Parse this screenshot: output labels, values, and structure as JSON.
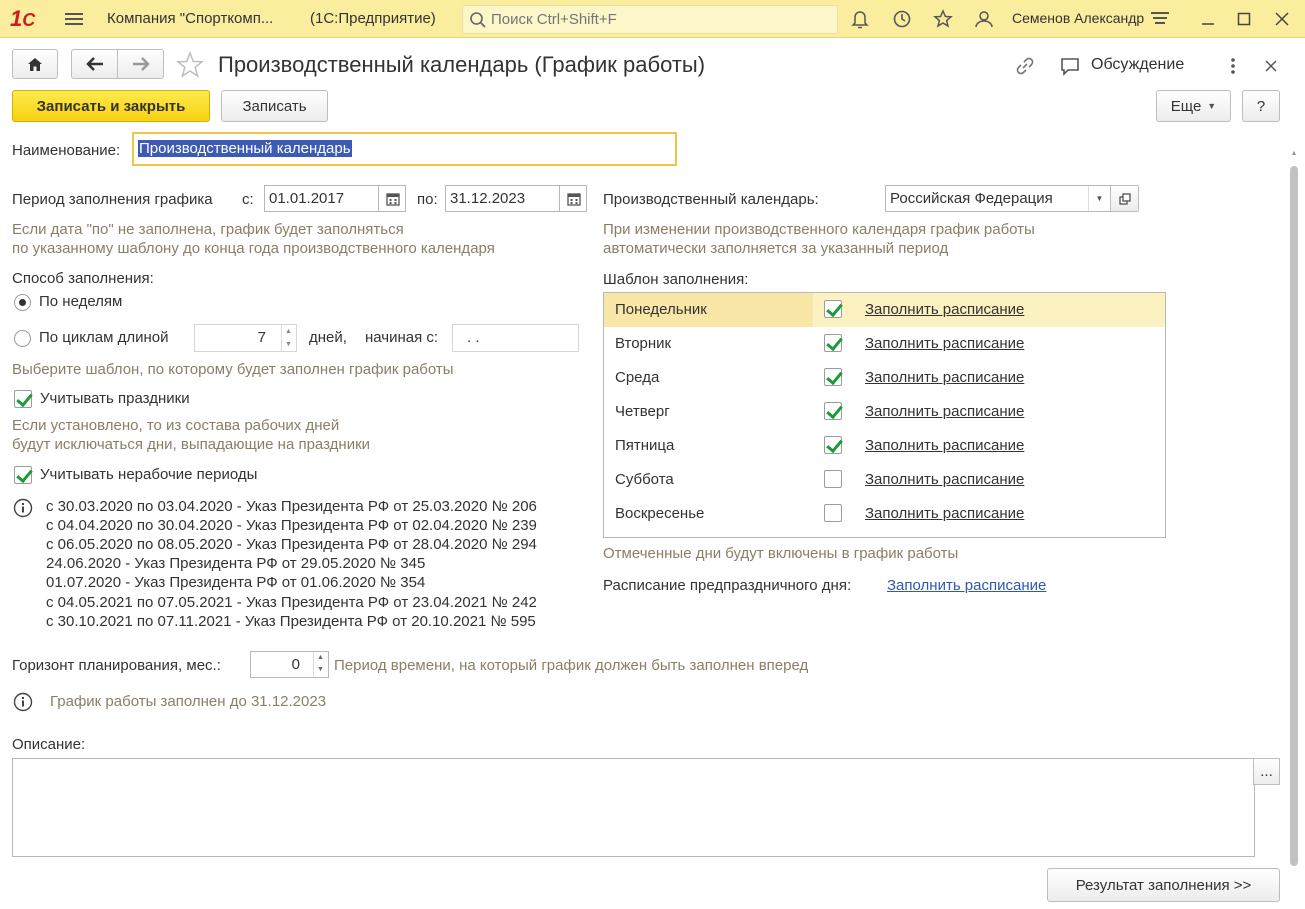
{
  "titlebar": {
    "app_name": "Компания \"Спорткомп...",
    "platform": "(1С:Предприятие)",
    "search_placeholder": "Поиск Ctrl+Shift+F",
    "user_name": "Семенов Александр"
  },
  "header": {
    "title": "Производственный календарь (График работы)",
    "discussion_label": "Обсуждение"
  },
  "toolbar": {
    "save_close_label": "Записать и закрыть",
    "save_label": "Записать",
    "more_label": "Еще",
    "help_label": "?"
  },
  "form": {
    "name_label": "Наименование:",
    "name_value": "Производственный календарь",
    "period_label": "Период заполнения графика",
    "period_from_label": "с:",
    "period_from": "01.01.2017",
    "period_to_label": "по:",
    "period_to": "31.12.2023",
    "period_hint_1": "Если дата \"по\" не заполнена, график будет заполняться",
    "period_hint_2": "по указанному шаблону до конца года производственного календаря",
    "fill_method_label": "Способ заполнения:",
    "by_weeks_label": "По неделям",
    "by_cycles_label": "По циклам длиной",
    "cycle_length": "7",
    "days_label": "дней,",
    "starting_label": "начиная с:",
    "starting_value": " .  .",
    "template_hint": "Выберите шаблон, по которому будет заполнен график работы",
    "holidays_label": "Учитывать праздники",
    "holidays_hint_1": "Если установлено, то из состава рабочих дней",
    "holidays_hint_2": "будут исключаться дни, выпадающие на праздники",
    "nonwork_label": "Учитывать нерабочие периоды",
    "nonwork_periods": [
      "с 30.03.2020 по 03.04.2020 - Указ Президента РФ от 25.03.2020 № 206",
      "с 04.04.2020 по 30.04.2020 - Указ Президента РФ от 02.04.2020 № 239",
      "с 06.05.2020 по 08.05.2020 - Указ Президента РФ от 28.04.2020 № 294",
      "24.06.2020 - Указ Президента РФ от 29.05.2020 № 345",
      "01.07.2020 - Указ Президента РФ от 01.06.2020 № 354",
      "с 04.05.2021 по 07.05.2021 - Указ Президента РФ от 23.04.2021 № 242",
      "с 30.10.2021 по 07.11.2021 - Указ Президента РФ от 20.10.2021 № 595"
    ],
    "horizon_label": "Горизонт планирования, мес.:",
    "horizon_value": "0",
    "horizon_hint": "Период времени, на который график должен быть заполнен вперед",
    "filled_until": "График работы заполнен до 31.12.2023",
    "description_label": "Описание:",
    "description_more": "...",
    "result_button": "Результат заполнения >>"
  },
  "right": {
    "calendar_label": "Производственный календарь:",
    "calendar_value": "Российская Федерация",
    "calendar_hint_1": "При изменении производственного календаря график работы",
    "calendar_hint_2": "автоматически заполняется за указанный период",
    "template_label": "Шаблон заполнения:",
    "days": [
      {
        "name": "Понедельник",
        "checked": true,
        "link": "Заполнить расписание"
      },
      {
        "name": "Вторник",
        "checked": true,
        "link": "Заполнить расписание"
      },
      {
        "name": "Среда",
        "checked": true,
        "link": "Заполнить расписание"
      },
      {
        "name": "Четверг",
        "checked": true,
        "link": "Заполнить расписание"
      },
      {
        "name": "Пятница",
        "checked": true,
        "link": "Заполнить расписание"
      },
      {
        "name": "Суббота",
        "checked": false,
        "link": "Заполнить расписание"
      },
      {
        "name": "Воскресенье",
        "checked": false,
        "link": "Заполнить расписание"
      }
    ],
    "marked_hint": "Отмеченные дни будут включены в график работы",
    "preholiday_label": "Расписание предпраздничного дня:",
    "preholiday_link": "Заполнить расписание"
  },
  "colors": {
    "titlebar_bg": "#fbed9e",
    "primary_button": "#f6d20e",
    "link_blue": "#2f57b4",
    "check_green": "#1a9c3a",
    "selection": "#3d5ab5"
  }
}
